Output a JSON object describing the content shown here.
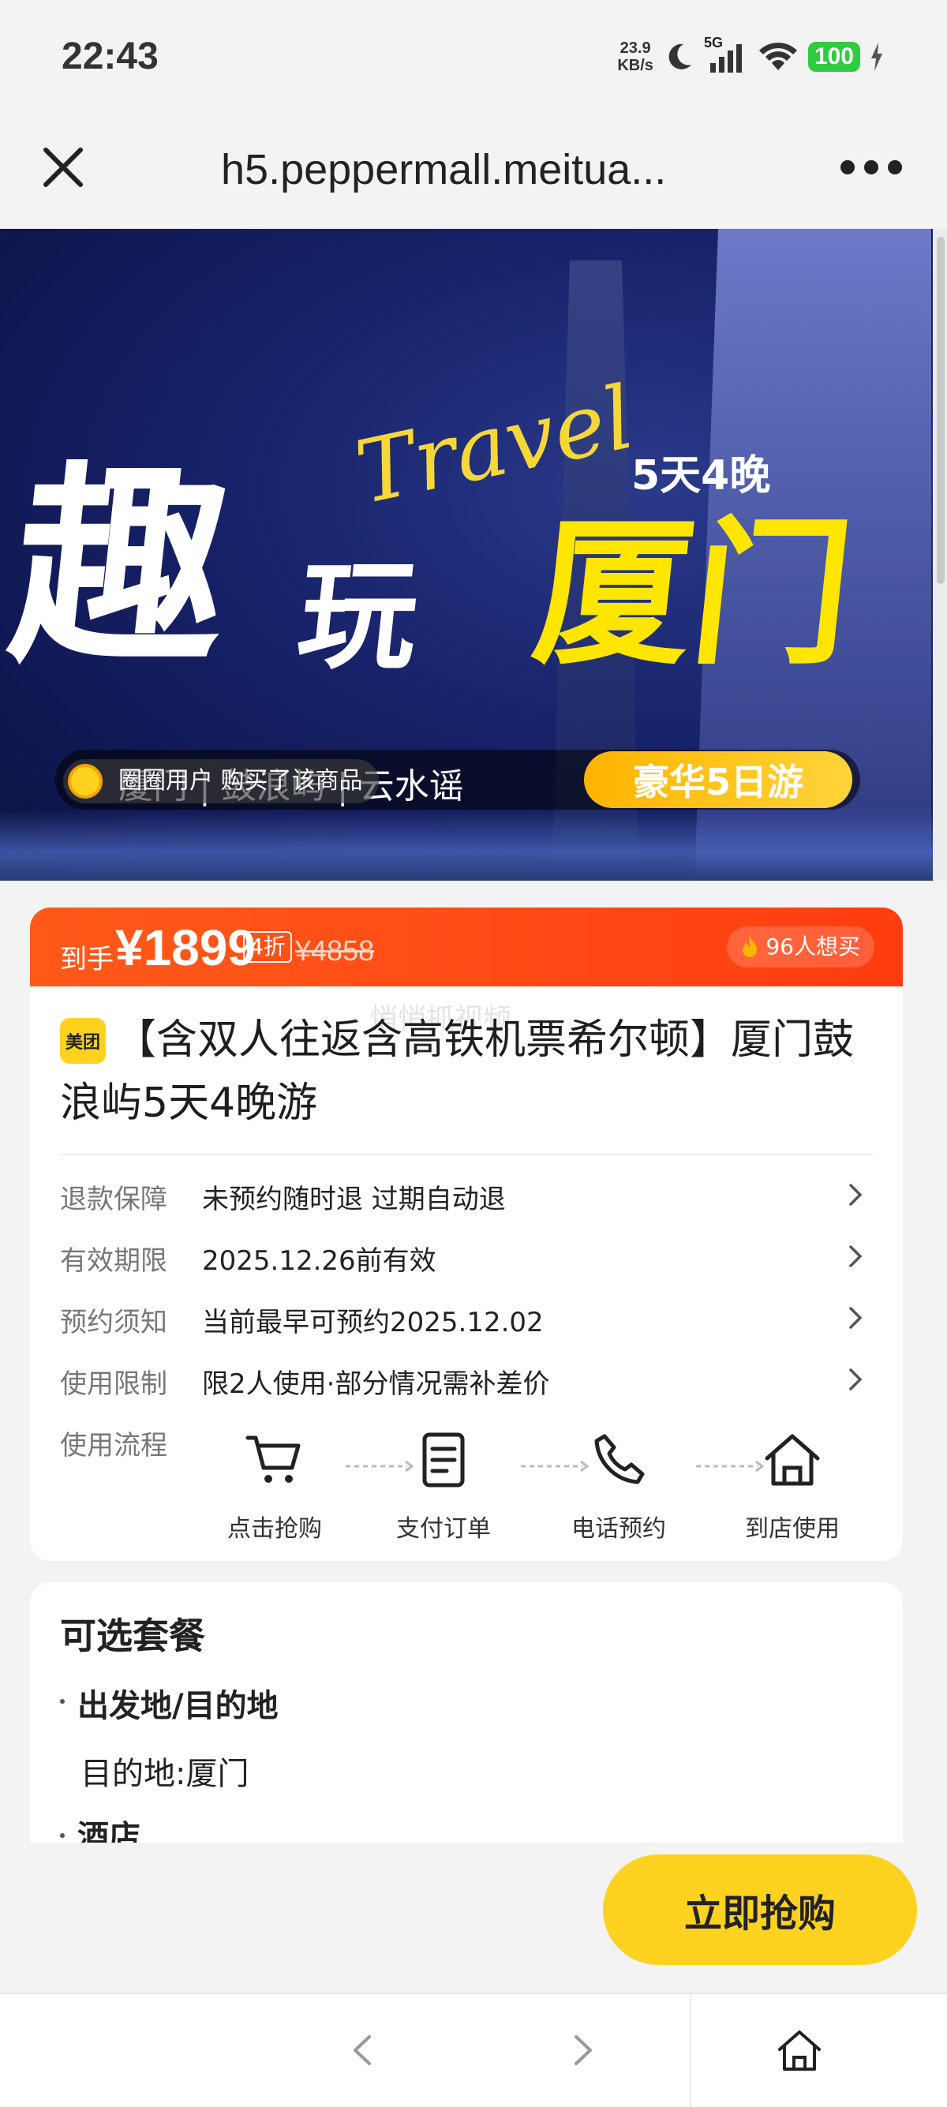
{
  "status_bar": {
    "time": "22:43",
    "net_speed_value": "23.9",
    "net_speed_unit": "KB/s",
    "network": "5G",
    "battery": "100"
  },
  "nav": {
    "url": "h5.peppermall.meitua..."
  },
  "banner": {
    "title_part1": "趣",
    "title_part2": "玩",
    "title_part3": "厦门",
    "script_text": "Travel",
    "duration": "5天4晚",
    "route": "厦门 | 鼓浪屿 | 云水谣",
    "tour_badge": "豪华5日游",
    "buyer_notice": "圈圈用户 购买了该商品"
  },
  "product": {
    "price_label": "到手",
    "price": "¥1899",
    "discount": "4折",
    "original_price": "¥4858",
    "want_count": "96人想买",
    "watermark": "悄悄抓视频",
    "brand_logo": "美团",
    "title": "【含双人往返含高铁机票希尔顿】厦门鼓浪屿5天4晚游",
    "info_rows": [
      {
        "label": "退款保障",
        "value": "未预约随时退 过期自动退"
      },
      {
        "label": "有效期限",
        "value": "2025.12.26前有效"
      },
      {
        "label": "预约须知",
        "value": "当前最早可预约2025.12.02"
      },
      {
        "label": "使用限制",
        "value": "限2人使用·部分情况需补差价"
      }
    ],
    "flow_label": "使用流程",
    "flow_steps": [
      {
        "label": "点击抢购",
        "icon": "cart-icon"
      },
      {
        "label": "支付订单",
        "icon": "document-icon"
      },
      {
        "label": "电话预约",
        "icon": "phone-icon"
      },
      {
        "label": "到店使用",
        "icon": "home-icon"
      }
    ]
  },
  "package": {
    "title": "可选套餐",
    "section1_title": "出发地/目的地",
    "section1_value": "目的地:厦门",
    "section2_title": "酒店"
  },
  "actions": {
    "buy_now": "立即抢购"
  },
  "colors": {
    "accent_orange": "#ff4a14",
    "brand_yellow": "#ffd21f"
  }
}
